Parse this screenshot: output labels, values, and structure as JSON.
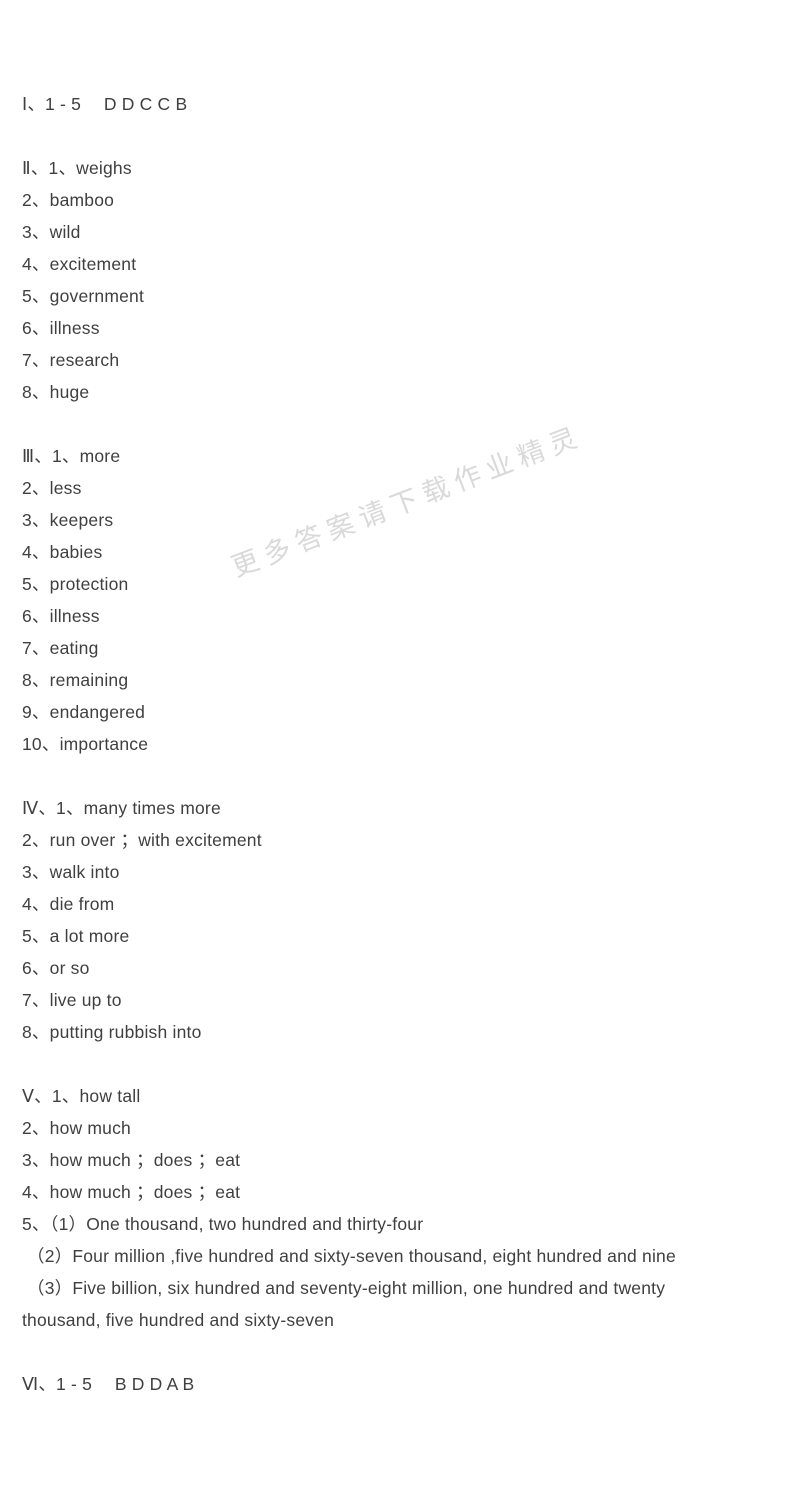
{
  "document": {
    "background_color": "#ffffff",
    "text_color": "#3f3f3f",
    "watermark": {
      "text": "更多答案请下载作业精灵",
      "color": "#d9d9d9",
      "rotation_degrees": -21
    }
  },
  "sections": [
    {
      "id": "section-1",
      "numeral": "Ⅰ",
      "lines": [
        "Ⅰ、1 - 5　 D D C C B"
      ]
    },
    {
      "id": "section-2",
      "numeral": "Ⅱ",
      "lines": [
        "Ⅱ、1、weighs",
        "2、bamboo",
        "3、wild",
        "4、excitement",
        "5、government",
        "6、illness",
        "7、research",
        "8、huge"
      ]
    },
    {
      "id": "section-3",
      "numeral": "Ⅲ",
      "lines": [
        "Ⅲ、1、more",
        "2、less",
        "3、keepers",
        "4、babies",
        "5、protection",
        "6、illness",
        "7、eating",
        "8、remaining",
        "9、endangered",
        "10、importance"
      ]
    },
    {
      "id": "section-4",
      "numeral": "Ⅳ",
      "lines": [
        "Ⅳ、1、many times more",
        "2、run over ；with excitement",
        "3、walk into",
        "4、die from",
        "5、a lot more",
        "6、or so",
        "7、live up to",
        "8、putting rubbish into"
      ]
    },
    {
      "id": "section-5",
      "numeral": "Ⅴ",
      "lines": [
        "Ⅴ、1、how tall",
        "2、how much",
        "3、how much ；does ；eat",
        "4、how much ；does ；eat",
        "5、（1）One thousand, two hundred and thirty-four",
        "（2）Four million ,five hundred and sixty-seven thousand, eight hundred and nine",
        "（3）Five billion, six hundred and seventy-eight million, one hundred and twenty",
        "thousand, five hundred and sixty-seven"
      ]
    },
    {
      "id": "section-6",
      "numeral": "Ⅵ",
      "lines": [
        "Ⅵ、1 - 5　 B D D A B"
      ]
    }
  ]
}
